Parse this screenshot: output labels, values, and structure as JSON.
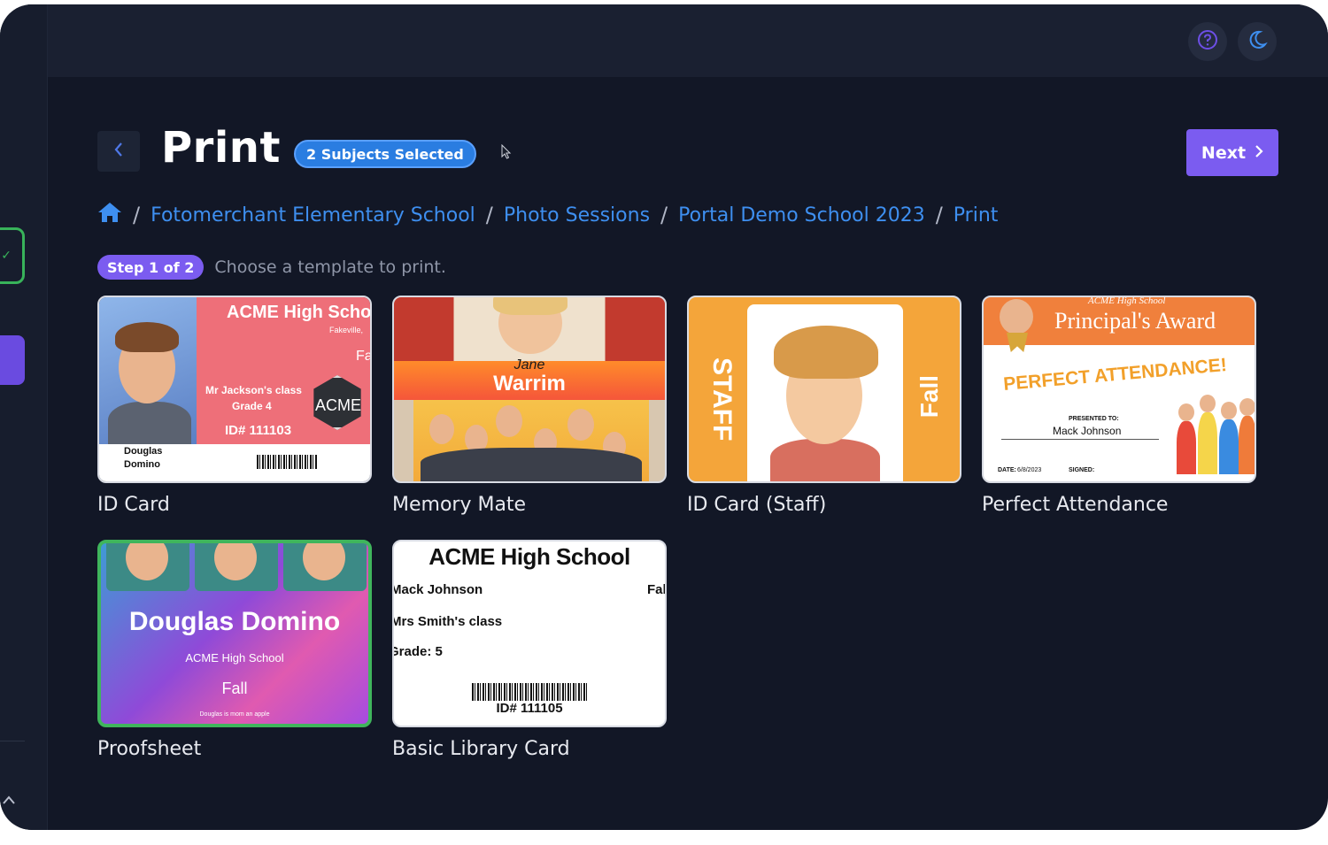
{
  "header": {
    "help_icon": "question-circle-icon",
    "theme_icon": "moon-icon"
  },
  "page": {
    "title": "Print",
    "subjects_badge": "2 Subjects Selected",
    "next_label": "Next"
  },
  "breadcrumb": {
    "home_icon": "home-icon",
    "items": [
      "Fotomerchant Elementary School",
      "Photo Sessions",
      "Portal Demo School 2023",
      "Print"
    ]
  },
  "step": {
    "badge": "Step 1 of 2",
    "text": "Choose a template to print."
  },
  "templates": [
    {
      "label": "ID Card",
      "preview": {
        "school": "ACME High Schoo",
        "town": "Fakeville,",
        "side": "Fa",
        "class": "Mr Jackson's class",
        "grade": "Grade 4",
        "id": "ID# 111103",
        "name_first": "Douglas",
        "name_last": "Domino",
        "seal": "ACME"
      }
    },
    {
      "label": "Memory Mate",
      "preview": {
        "first": "Jane",
        "last": "Warrim"
      }
    },
    {
      "label": "ID Card (Staff)",
      "preview": {
        "left": "STAFF",
        "right": "Fall"
      }
    },
    {
      "label": "Perfect Attendance",
      "preview": {
        "school": "ACME High School",
        "award": "Principal's Award",
        "banner": "PERFECT ATTENDANCE!",
        "presented": "PRESENTED TO:",
        "name": "Mack Johnson",
        "date_label": "DATE:",
        "date": "6/8/2023",
        "signed": "SIGNED:"
      }
    },
    {
      "label": "Proofsheet",
      "selected": true,
      "preview": {
        "name": "Douglas Domino",
        "school": "ACME High School",
        "season": "Fall",
        "footer": "Douglas is mom an apple"
      }
    },
    {
      "label": "Basic Library Card",
      "preview": {
        "school": "ACME High School",
        "name": "Mack Johnson",
        "season": "Fal",
        "class": "Mrs Smith's class",
        "grade": "Grade: 5",
        "id": "ID# 111105"
      }
    }
  ],
  "colors": {
    "accent": "#7b5cf0",
    "link": "#3e8ff0",
    "badge": "#2a7de1",
    "selected_border": "#3fb55c",
    "background": "#121726"
  }
}
